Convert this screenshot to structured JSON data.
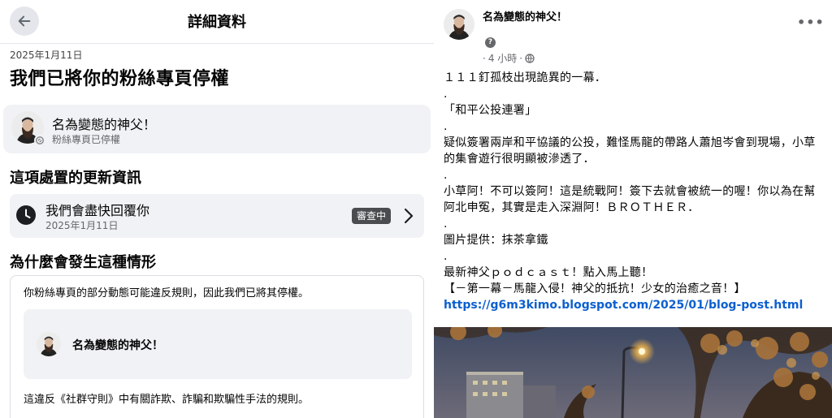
{
  "details": {
    "header_title": "詳細資料",
    "date": "2025年1月11日",
    "headline": "我們已將你的粉絲專頁停權",
    "page_name": "名為變態的神父！",
    "page_status": "粉絲專頁已停權",
    "update_section_title": "這項處置的更新資訊",
    "update_title": "我們會盡快回覆你",
    "update_date": "2025年1月11日",
    "update_badge": "審查中",
    "reason_section_title": "為什麼會發生這種情形",
    "reason_text": "你粉絲專頁的部分動態可能違反規則，因此我們已將其停權。",
    "inner_page_name": "名為變態的神父！",
    "violation_text": "這違反《社群守則》中有關詐欺、詐騙和欺騙性手法的規則。"
  },
  "post": {
    "author": "名為變態的神父！",
    "more_label": "•••",
    "help_label": "?",
    "meta_dot": "·",
    "time": "4 小時",
    "lines": [
      "１１１釘孤枝出現詭異的一幕．",
      ".",
      "「和平公投連署」",
      ".",
      "疑似簽署兩岸和平協議的公投，難怪馬龍的帶路人蕭旭岑會到現場，小草的集會遊行很明顯被滲透了．",
      ".",
      "小草阿！不可以簽阿！這是統戰阿！簽下去就會被統一的喔！你以為在幫阿北申冤，其實是走入深淵阿！ＢＲＯＴＨＥＲ．",
      ".",
      "圖片提供：抹茶拿鐵",
      ".",
      "最新神父ｐｏｄｃａｓｔ！點入馬上聽！",
      "【－第一幕－馬龍入侵！神父的抵抗！少女的治癒之音！】"
    ],
    "link": "https://g6m3kimo.blogspot.com/2025/01/blog-post.html"
  },
  "colors": {
    "accent_link": "#0c5fcf",
    "card_bg": "#f0f2f5",
    "badge_bg": "#4b4c4f",
    "muted_text": "#65676b"
  },
  "icons": [
    "back-arrow-icon",
    "clock-icon",
    "chevron-right-icon",
    "blocked-badge-icon",
    "help-icon",
    "globe-icon",
    "more-icon"
  ]
}
